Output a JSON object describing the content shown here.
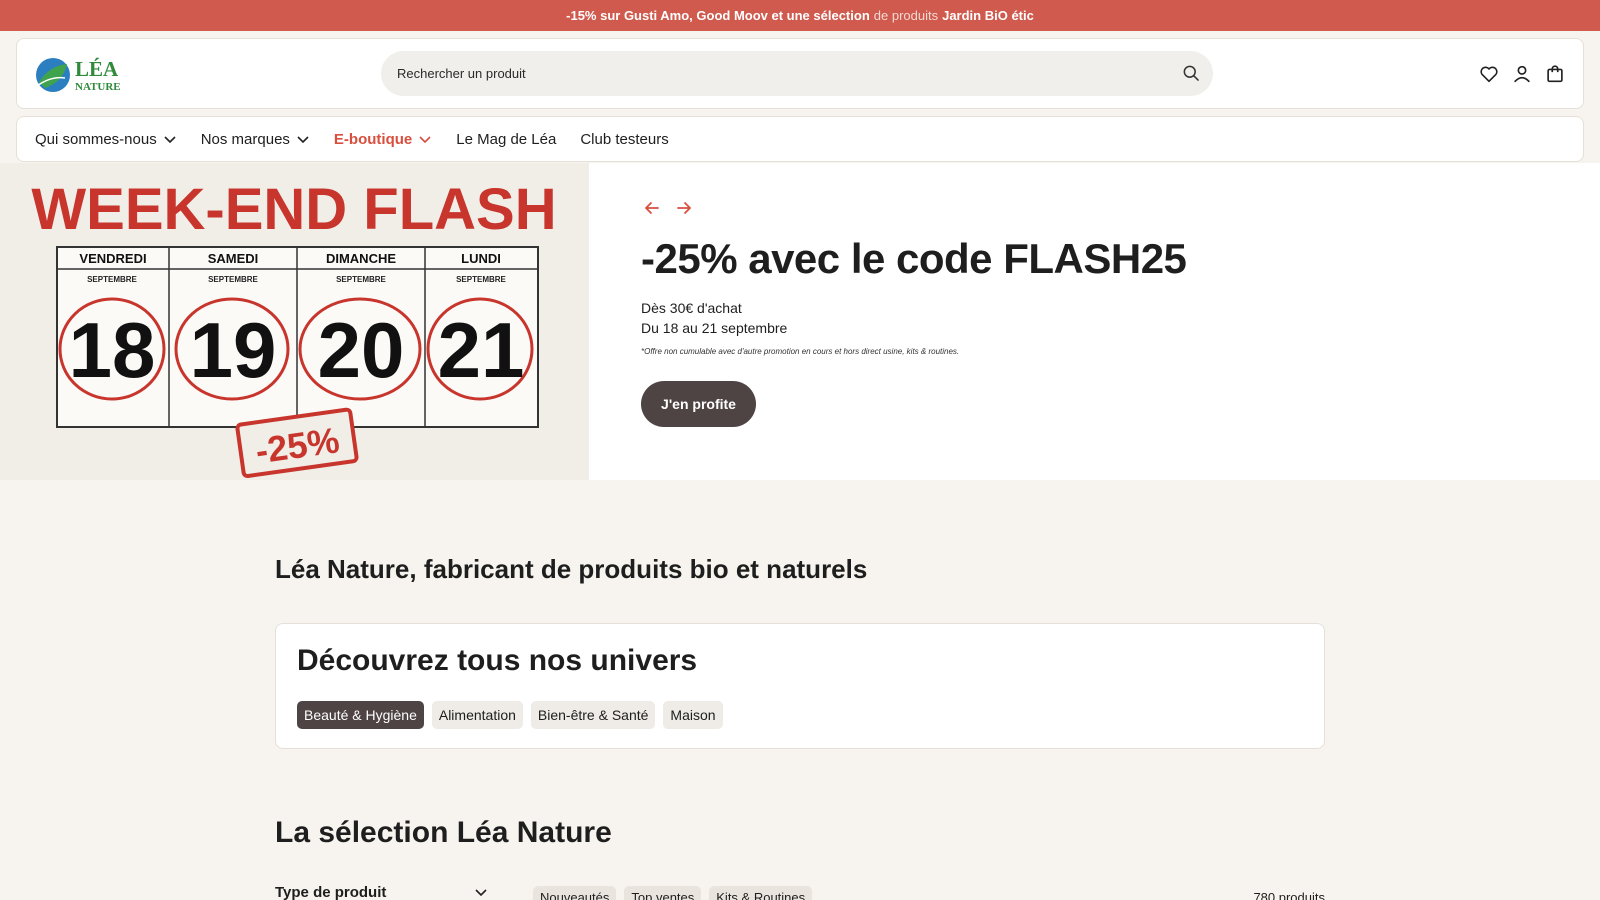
{
  "promo_bar": {
    "part1": "-15% sur Gusti Amo, Good Moov et une sélection",
    "part2": "de produits",
    "part3": "Jardin BiO étic"
  },
  "header": {
    "logo_text_top": "LÉA",
    "logo_text_bottom": "NATURE",
    "search_placeholder": "Rechercher un produit",
    "icons": [
      "heart-icon",
      "user-icon",
      "bag-icon"
    ]
  },
  "nav": {
    "items": [
      {
        "label": "Qui sommes-nous",
        "dropdown": true
      },
      {
        "label": "Nos marques",
        "dropdown": true
      },
      {
        "label": "E-boutique",
        "dropdown": true,
        "active": true
      },
      {
        "label": "Le Mag de Léa",
        "dropdown": false
      },
      {
        "label": "Club testeurs",
        "dropdown": false
      }
    ]
  },
  "hero_image": {
    "title": "WEEK-END FLASH",
    "month": "SEPTEMBRE",
    "days": [
      {
        "name": "VENDREDI",
        "num": "18"
      },
      {
        "name": "SAMEDI",
        "num": "19"
      },
      {
        "name": "DIMANCHE",
        "num": "20"
      },
      {
        "name": "LUNDI",
        "num": "21"
      }
    ],
    "stamp": "-25%"
  },
  "hero": {
    "title": "-25% avec le code FLASH25",
    "line1": "Dès 30€ d'achat",
    "line2": "Du 18 au 21 septembre",
    "note": "*Offre non cumulable avec d'autre promotion en cours et hors direct usine, kits & routines.",
    "cta": "J'en profite"
  },
  "main": {
    "heading": "Léa Nature, fabricant de produits bio et naturels",
    "univers": {
      "title": "Découvrez tous nos univers",
      "chips": [
        "Beauté & Hygiène",
        "Alimentation",
        "Bien-être & Santé",
        "Maison"
      ],
      "selected": "Beauté & Hygiène"
    },
    "selection": {
      "title": "La sélection Léa Nature",
      "filter_label": "Type de produit",
      "tags": [
        "Nouveautés",
        "Top ventes",
        "Kits & Routines"
      ],
      "count": "780 produits"
    }
  },
  "colors": {
    "promo_bg": "#cf5a4d",
    "accent": "#d84f3e",
    "dark_button": "#4e4443",
    "page_bg": "#f7f3ee",
    "logo_green": "#2f8a3a",
    "logo_blue": "#2b7fc1"
  }
}
